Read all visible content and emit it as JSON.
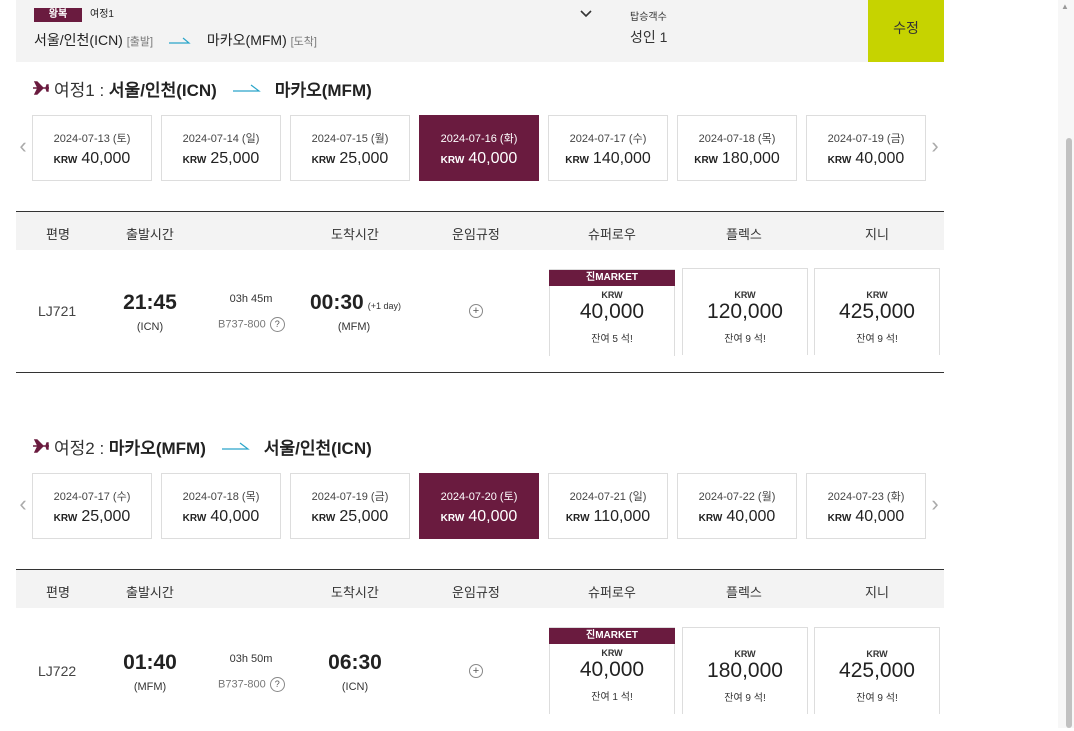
{
  "search": {
    "trip_type": "왕복",
    "trip_label": "여정1",
    "origin": "서울/인천(ICN)",
    "origin_tag": "[출발]",
    "destination": "마카오(MFM)",
    "destination_tag": "[도착]",
    "pax_label": "탑승객수",
    "pax_value": "성인 1",
    "edit_label": "수정"
  },
  "journeys": [
    {
      "num_label": "여정1 :",
      "from": "서울/인천(ICN)",
      "to": "마카오(MFM)",
      "dates": [
        {
          "date": "2024-07-13 (토)",
          "cur": "KRW",
          "price": "40,000"
        },
        {
          "date": "2024-07-14 (일)",
          "cur": "KRW",
          "price": "25,000"
        },
        {
          "date": "2024-07-15 (월)",
          "cur": "KRW",
          "price": "25,000"
        },
        {
          "date": "2024-07-16 (화)",
          "cur": "KRW",
          "price": "40,000"
        },
        {
          "date": "2024-07-17 (수)",
          "cur": "KRW",
          "price": "140,000"
        },
        {
          "date": "2024-07-18 (목)",
          "cur": "KRW",
          "price": "180,000"
        },
        {
          "date": "2024-07-19 (금)",
          "cur": "KRW",
          "price": "40,000"
        }
      ],
      "flight": {
        "no": "LJ721",
        "dep_time": "21:45",
        "dep_ap": "(ICN)",
        "duration": "03h 45m",
        "aircraft": "B737-800",
        "arr_time": "00:30",
        "next_day": "(+1 day)",
        "arr_ap": "(MFM)",
        "fares": [
          {
            "tag": "진MARKET",
            "cur": "KRW",
            "amt": "40,000",
            "seat": "잔여 5 석!"
          },
          {
            "tag": "",
            "cur": "KRW",
            "amt": "120,000",
            "seat": "잔여 9 석!"
          },
          {
            "tag": "",
            "cur": "KRW",
            "amt": "425,000",
            "seat": "잔여 9 석!"
          }
        ]
      }
    },
    {
      "num_label": "여정2 :",
      "from": "마카오(MFM)",
      "to": "서울/인천(ICN)",
      "dates": [
        {
          "date": "2024-07-17 (수)",
          "cur": "KRW",
          "price": "25,000"
        },
        {
          "date": "2024-07-18 (목)",
          "cur": "KRW",
          "price": "40,000"
        },
        {
          "date": "2024-07-19 (금)",
          "cur": "KRW",
          "price": "25,000"
        },
        {
          "date": "2024-07-20 (토)",
          "cur": "KRW",
          "price": "40,000"
        },
        {
          "date": "2024-07-21 (일)",
          "cur": "KRW",
          "price": "110,000"
        },
        {
          "date": "2024-07-22 (월)",
          "cur": "KRW",
          "price": "40,000"
        },
        {
          "date": "2024-07-23 (화)",
          "cur": "KRW",
          "price": "40,000"
        }
      ],
      "flight": {
        "no": "LJ722",
        "dep_time": "01:40",
        "dep_ap": "(MFM)",
        "duration": "03h 50m",
        "aircraft": "B737-800",
        "arr_time": "06:30",
        "next_day": "",
        "arr_ap": "(ICN)",
        "fares": [
          {
            "tag": "진MARKET",
            "cur": "KRW",
            "amt": "40,000",
            "seat": "잔여 1 석!"
          },
          {
            "tag": "",
            "cur": "KRW",
            "amt": "180,000",
            "seat": "잔여 9 석!"
          },
          {
            "tag": "",
            "cur": "KRW",
            "amt": "425,000",
            "seat": "잔여 9 석!"
          }
        ]
      }
    }
  ],
  "table_headers": {
    "flight_no": "편명",
    "dep": "출발시간",
    "arr": "도착시간",
    "rules": "운임규정",
    "fare1": "슈퍼로우",
    "fare2": "플렉스",
    "fare3": "지니"
  },
  "colors": {
    "brand": "#6a1b3f",
    "accent": "#c6d300"
  }
}
